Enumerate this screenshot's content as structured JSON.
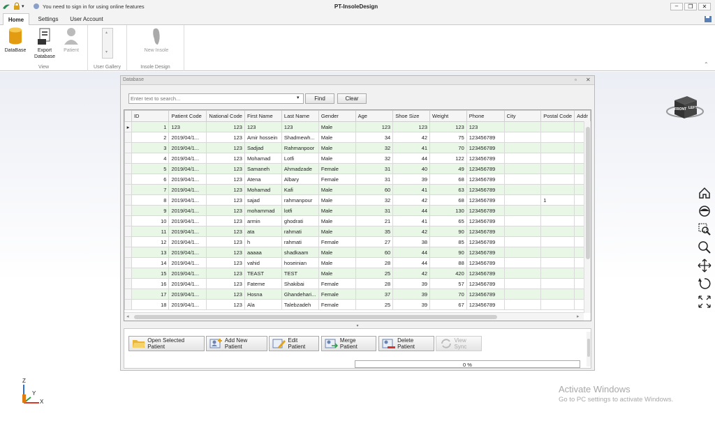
{
  "app": {
    "title": "PT-InsoleDesign",
    "signin_notice": "You need to sign in for using online features"
  },
  "tabs": [
    "Home",
    "Settings",
    "User Account"
  ],
  "ribbon": {
    "view_group": {
      "label": "View",
      "database": "DataBase",
      "export": "Export Database",
      "patient": "Patient"
    },
    "gallery_group": {
      "label": "User Gallery"
    },
    "insole_group": {
      "label": "Insole Design",
      "new_insole": "New Insole"
    }
  },
  "db_window": {
    "title": "Database",
    "search_placeholder": "Enter text to search...",
    "find": "Find",
    "clear": "Clear",
    "columns": [
      "ID",
      "Patient Code",
      "National Code",
      "First Name",
      "Last Name",
      "Gender",
      "Age",
      "Shoe Size",
      "Weight",
      "Phone",
      "City",
      "Postal Code",
      "Addr"
    ],
    "rows": [
      [
        "1",
        "123",
        "123",
        "123",
        "123",
        "Male",
        "123",
        "123",
        "123",
        "123",
        "",
        ""
      ],
      [
        "2",
        "2019/04/1...",
        "123",
        "Amir hossein",
        "Shadmewh...",
        "Male",
        "34",
        "42",
        "75",
        "123456789",
        "",
        ""
      ],
      [
        "3",
        "2019/04/1...",
        "123",
        "Sadjad",
        "Rahmanpoor",
        "Male",
        "32",
        "41",
        "70",
        "123456789",
        "",
        ""
      ],
      [
        "4",
        "2019/04/1...",
        "123",
        "Mohamad",
        "Lotfi",
        "Male",
        "32",
        "44",
        "122",
        "123456789",
        "",
        ""
      ],
      [
        "5",
        "2019/04/1...",
        "123",
        "Samaneh",
        "Ahmadzade",
        "Female",
        "31",
        "40",
        "49",
        "123456789",
        "",
        ""
      ],
      [
        "6",
        "2019/04/1...",
        "123",
        "Atena",
        "Albary",
        "Female",
        "31",
        "39",
        "68",
        "123456789",
        "",
        ""
      ],
      [
        "7",
        "2019/04/1...",
        "123",
        "Mohamad",
        "Kafi",
        "Male",
        "60",
        "41",
        "63",
        "123456789",
        "",
        ""
      ],
      [
        "8",
        "2019/04/1...",
        "123",
        "sajad",
        "rahmanpour",
        "Male",
        "32",
        "42",
        "68",
        "123456789",
        "",
        "1"
      ],
      [
        "9",
        "2019/04/1...",
        "123",
        "mohammad",
        "lotfi",
        "Male",
        "31",
        "44",
        "130",
        "123456789",
        "",
        ""
      ],
      [
        "10",
        "2019/04/1...",
        "123",
        "armin",
        "ghodrati",
        "Male",
        "21",
        "41",
        "65",
        "123456789",
        "",
        ""
      ],
      [
        "11",
        "2019/04/1...",
        "123",
        "ata",
        "rahmati",
        "Male",
        "35",
        "42",
        "90",
        "123456789",
        "",
        ""
      ],
      [
        "12",
        "2019/04/1...",
        "123",
        "h",
        "rahmati",
        "Female",
        "27",
        "38",
        "85",
        "123456789",
        "",
        ""
      ],
      [
        "13",
        "2019/04/1...",
        "123",
        "aaaaa",
        "shadkaam",
        "Male",
        "60",
        "44",
        "90",
        "123456789",
        "",
        ""
      ],
      [
        "14",
        "2019/04/1...",
        "123",
        "vahid",
        "hoseinian",
        "Male",
        "28",
        "44",
        "88",
        "123456789",
        "",
        ""
      ],
      [
        "15",
        "2019/04/1...",
        "123",
        "TEAST",
        "TEST",
        "Male",
        "25",
        "42",
        "420",
        "123456789",
        "",
        ""
      ],
      [
        "16",
        "2019/04/1...",
        "123",
        "Fateme",
        "Shakibai",
        "Female",
        "28",
        "39",
        "57",
        "123456789",
        "",
        ""
      ],
      [
        "17",
        "2019/04/1...",
        "123",
        "Hosna",
        "Ghandehari...",
        "Female",
        "37",
        "39",
        "70",
        "123456789",
        "",
        ""
      ],
      [
        "18",
        "2019/04/1...",
        "123",
        "Ala",
        "Talebzadeh",
        "Female",
        "25",
        "39",
        "67",
        "123456789",
        "",
        ""
      ]
    ],
    "actions": {
      "open": "Open Selected Patient",
      "add": "Add New Patient",
      "edit": "Edit Patient",
      "merge": "Merge Patient",
      "delete": "Delete Patient",
      "sync": "View Sync"
    },
    "progress": {
      "value": 0,
      "label": "0 %"
    }
  },
  "viewcube": {
    "front": "FRONT",
    "left": "LEFT"
  },
  "axes": {
    "z": "Z",
    "y": "Y",
    "x": "X"
  },
  "watermark": {
    "title": "Activate Windows",
    "subtitle": "Go to PC settings to activate Windows."
  },
  "colors": {
    "row_alt": "#e8f7e6",
    "accent": "#2b579a"
  }
}
